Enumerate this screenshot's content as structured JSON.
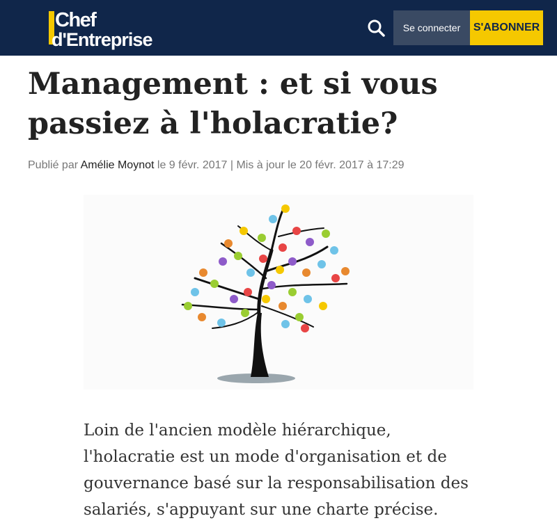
{
  "header": {
    "logo_line1": "Chef",
    "logo_line2": "d'Entreprise",
    "search_icon": "search-icon",
    "login_label": "Se connecter",
    "subscribe_label": "S'ABONNER",
    "bg_color": "#10264a",
    "accent_color": "#f5c800"
  },
  "article": {
    "title": "Management : et si vous passiez à l'holacratie?",
    "byline": {
      "prefix": "Publié par",
      "author": "Amélie Moynot",
      "published": "le 9 févr. 2017",
      "separator": "|",
      "updated": "Mis à jour le 20 févr. 2017 à 17:29"
    },
    "image_subject": "tree-with-people-illustration",
    "lead": "Loin de l'ancien modèle hiérarchique, l'holacratie est un mode d'organisation et de gouvernance basé sur la responsabilisation des salariés, s'appuyant sur une charte précise."
  }
}
